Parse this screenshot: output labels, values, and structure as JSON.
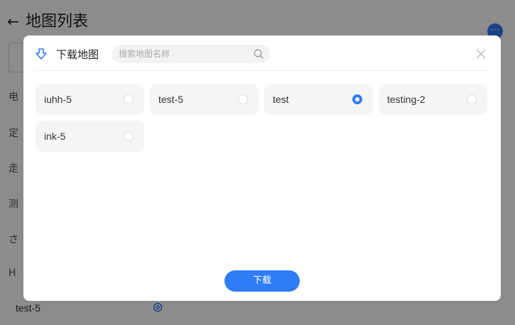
{
  "page": {
    "title": "地图列表",
    "back_icon": "arrow-left-icon",
    "more_icon": "more-dots-icon",
    "left_rows": [
      "电",
      "定",
      "走",
      "测",
      "さ",
      "H"
    ],
    "bottom_map_name": "test-5"
  },
  "dialog": {
    "title": "下载地图",
    "title_icon": "download-icon",
    "search_placeholder": "搜索地图名称",
    "search_value": "",
    "close_icon": "close-icon",
    "maps": [
      {
        "name": "iuhh-5",
        "selected": false
      },
      {
        "name": "test-5",
        "selected": false
      },
      {
        "name": "test",
        "selected": true
      },
      {
        "name": "testing-2",
        "selected": false
      },
      {
        "name": "ink-5",
        "selected": false
      }
    ],
    "download_label": "下载"
  },
  "colors": {
    "accent": "#2f7df6",
    "overlay": "rgba(0,0,0,0.45)",
    "card_bg": "#f5f5f5"
  }
}
